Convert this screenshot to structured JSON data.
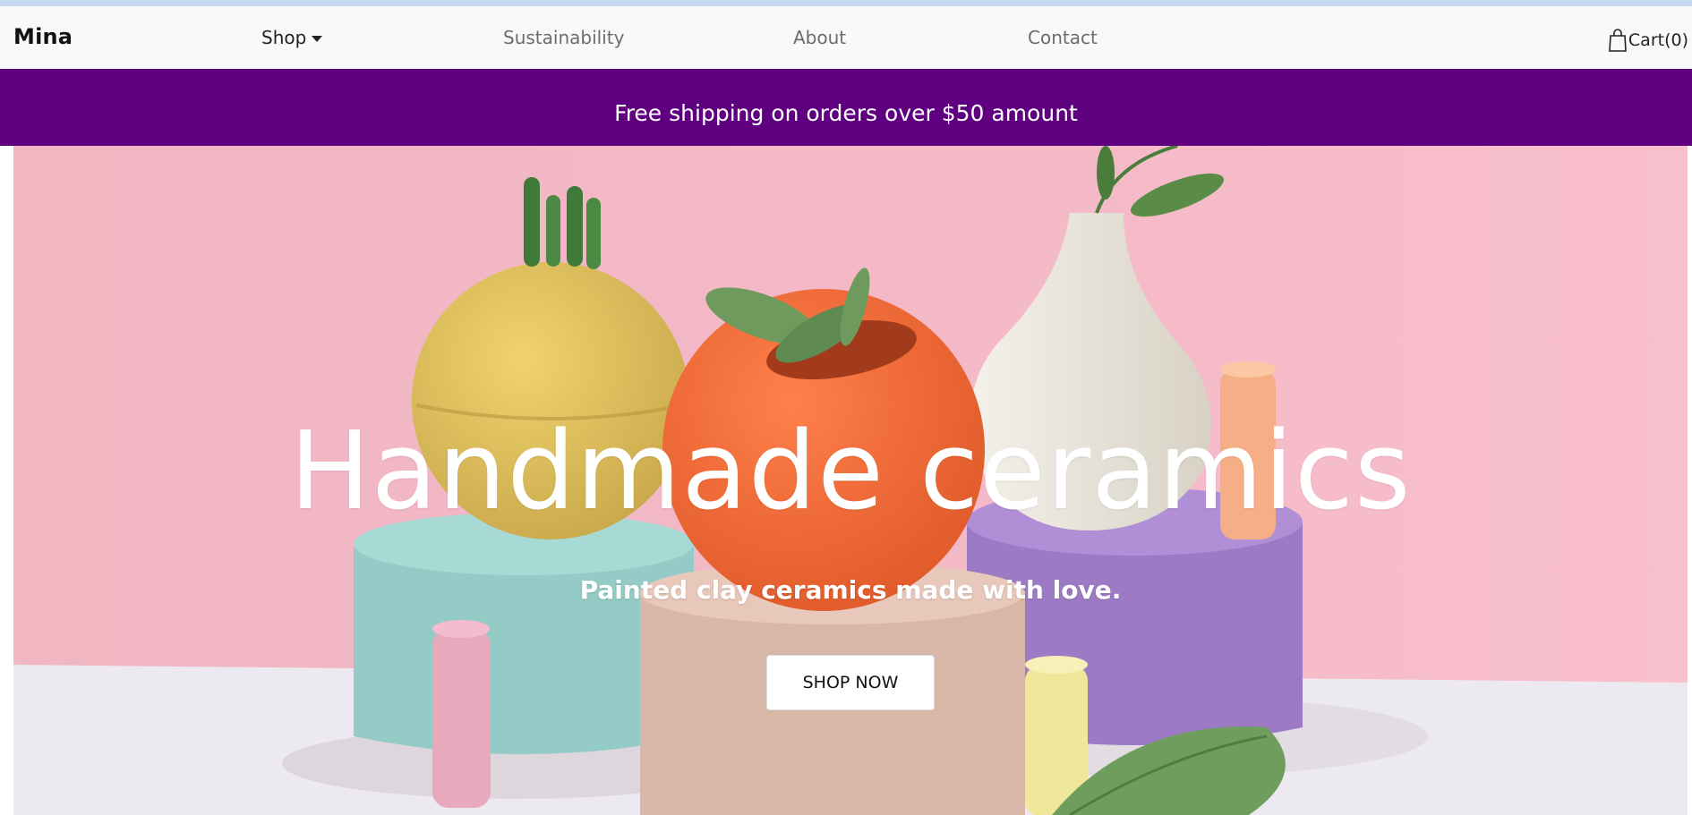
{
  "nav": {
    "brand": "Mina",
    "links": [
      "Shop",
      "Sustainability",
      "About",
      "Contact"
    ],
    "cart_label": "Cart(0)"
  },
  "promo": {
    "text": "Free shipping on orders over $50 amount"
  },
  "hero": {
    "title": "Handmade ceramics",
    "subtitle": "Painted clay ceramics made with love.",
    "cta": "SHOP NOW",
    "image": "ceramic-vases-still-life"
  },
  "colors": {
    "promo_bg": "#5f0080",
    "nav_bg": "#f8f9fa",
    "hero_bg": "#f2b9c6"
  },
  "icons": {
    "cart": "shopping-bag-icon",
    "dropdown": "caret-down-icon"
  }
}
